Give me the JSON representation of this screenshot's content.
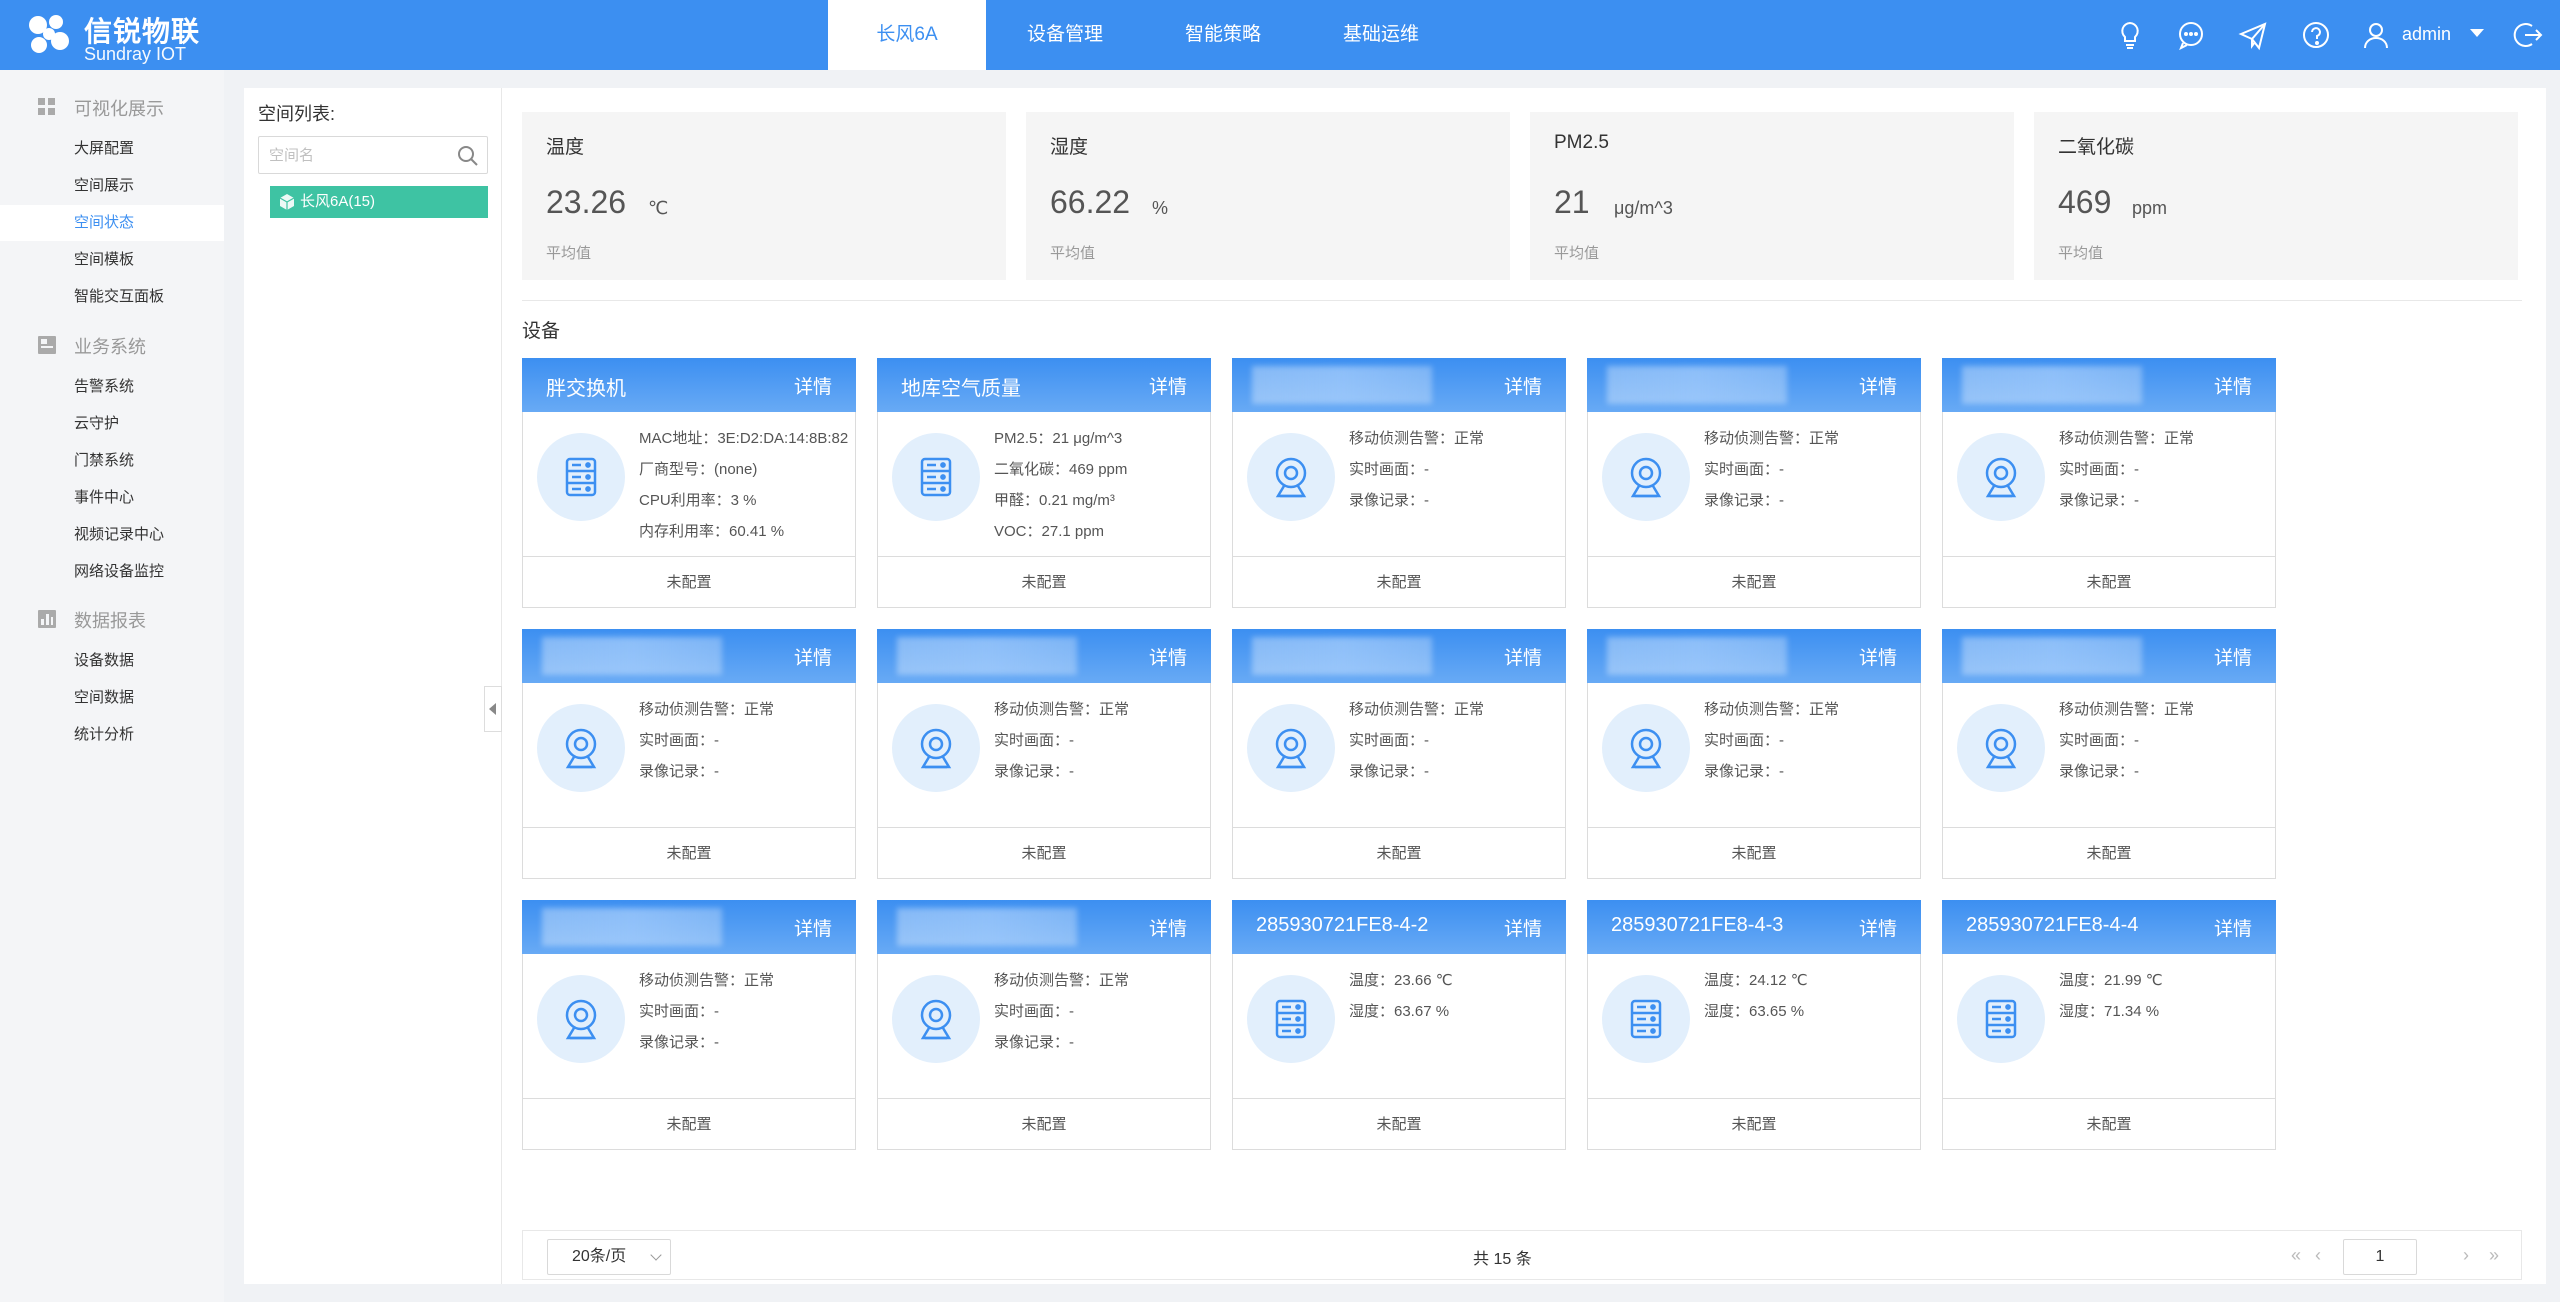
{
  "header": {
    "brand": {
      "title": "信锐物联",
      "subtitle": "Sundray IOT"
    },
    "nav": [
      {
        "label": "长风6A",
        "active": true
      },
      {
        "label": "设备管理",
        "active": false
      },
      {
        "label": "智能策略",
        "active": false
      },
      {
        "label": "基础运维",
        "active": false
      }
    ],
    "icons": [
      "lightbulb-icon",
      "chat-icon",
      "send-icon",
      "help-icon",
      "user-icon",
      "logout-icon"
    ],
    "user": "admin"
  },
  "sidebar": {
    "groups": [
      {
        "label": "可视化展示",
        "icon": "dashboard-icon",
        "items": [
          {
            "label": "大屏配置"
          },
          {
            "label": "空间展示"
          },
          {
            "label": "空间状态",
            "active": true
          },
          {
            "label": "空间模板"
          },
          {
            "label": "智能交互面板"
          }
        ]
      },
      {
        "label": "业务系统",
        "icon": "business-icon",
        "items": [
          {
            "label": "告警系统"
          },
          {
            "label": "云守护"
          },
          {
            "label": "门禁系统"
          },
          {
            "label": "事件中心"
          },
          {
            "label": "视频记录中心"
          },
          {
            "label": "网络设备监控"
          }
        ]
      },
      {
        "label": "数据报表",
        "icon": "chart-icon",
        "items": [
          {
            "label": "设备数据"
          },
          {
            "label": "空间数据"
          },
          {
            "label": "统计分析"
          }
        ]
      }
    ]
  },
  "space_list": {
    "title": "空间列表:",
    "search_placeholder": "空间名",
    "node": "长风6A(15)"
  },
  "stats": [
    {
      "label": "温度",
      "value": "23.26",
      "unit": "℃",
      "sub": "平均值"
    },
    {
      "label": "湿度",
      "value": "66.22",
      "unit": "%",
      "sub": "平均值"
    },
    {
      "label": "PM2.5",
      "value": "21",
      "unit": "μg/m^3",
      "sub": "平均值"
    },
    {
      "label": "二氧化碳",
      "value": "469",
      "unit": "ppm",
      "sub": "平均值"
    }
  ],
  "devices_title": "设备",
  "detail_label": "详情",
  "footer_label": "未配置",
  "devices": [
    {
      "name": "胖交换机",
      "icon": "server-icon",
      "props": [
        "MAC地址：3E:D2:DA:14:8B:82",
        "厂商型号：(none)",
        "CPU利用率：3 %",
        "内存利用率：60.41 %"
      ]
    },
    {
      "name": "地库空气质量",
      "icon": "server-icon",
      "props": [
        "PM2.5：21 μg/m^3",
        "二氧化碳：469 ppm",
        "甲醛：0.21 mg/m³",
        "VOC：27.1 ppm"
      ]
    },
    {
      "name": "",
      "icon": "camera-icon",
      "props": [
        "移动侦测告警：正常",
        "实时画面：-",
        "录像记录：-"
      ]
    },
    {
      "name": "",
      "icon": "camera-icon",
      "props": [
        "移动侦测告警：正常",
        "实时画面：-",
        "录像记录：-"
      ]
    },
    {
      "name": "",
      "icon": "camera-icon",
      "props": [
        "移动侦测告警：正常",
        "实时画面：-",
        "录像记录：-"
      ]
    },
    {
      "name": "",
      "icon": "camera-icon",
      "props": [
        "移动侦测告警：正常",
        "实时画面：-",
        "录像记录：-"
      ]
    },
    {
      "name": "",
      "icon": "camera-icon",
      "props": [
        "移动侦测告警：正常",
        "实时画面：-",
        "录像记录：-"
      ]
    },
    {
      "name": "",
      "icon": "camera-icon",
      "props": [
        "移动侦测告警：正常",
        "实时画面：-",
        "录像记录：-"
      ]
    },
    {
      "name": "",
      "icon": "camera-icon",
      "props": [
        "移动侦测告警：正常",
        "实时画面：-",
        "录像记录：-"
      ]
    },
    {
      "name": "",
      "icon": "camera-icon",
      "props": [
        "移动侦测告警：正常",
        "实时画面：-",
        "录像记录：-"
      ]
    },
    {
      "name": "",
      "icon": "camera-icon",
      "props": [
        "移动侦测告警：正常",
        "实时画面：-",
        "录像记录：-"
      ]
    },
    {
      "name": "",
      "icon": "camera-icon",
      "props": [
        "移动侦测告警：正常",
        "实时画面：-",
        "录像记录：-"
      ]
    },
    {
      "name": "285930721FE8-4-2",
      "icon": "server-icon",
      "props": [
        "温度：23.66 ℃",
        "湿度：63.67 %"
      ]
    },
    {
      "name": "285930721FE8-4-3",
      "icon": "server-icon",
      "props": [
        "温度：24.12 ℃",
        "湿度：63.65 %"
      ]
    },
    {
      "name": "285930721FE8-4-4",
      "icon": "server-icon",
      "props": [
        "温度：21.99 ℃",
        "湿度：71.34 %"
      ]
    }
  ],
  "pagination": {
    "page_size": "20条/页",
    "total": "共 15 条",
    "current_page": "1",
    "nav_glyphs": {
      "first": "«",
      "prev": "‹",
      "next": "›",
      "last": "»"
    }
  },
  "colors": {
    "primary": "#3c8ff1",
    "active_node": "#3ec3a3",
    "icon_bg": "#e2effc"
  }
}
